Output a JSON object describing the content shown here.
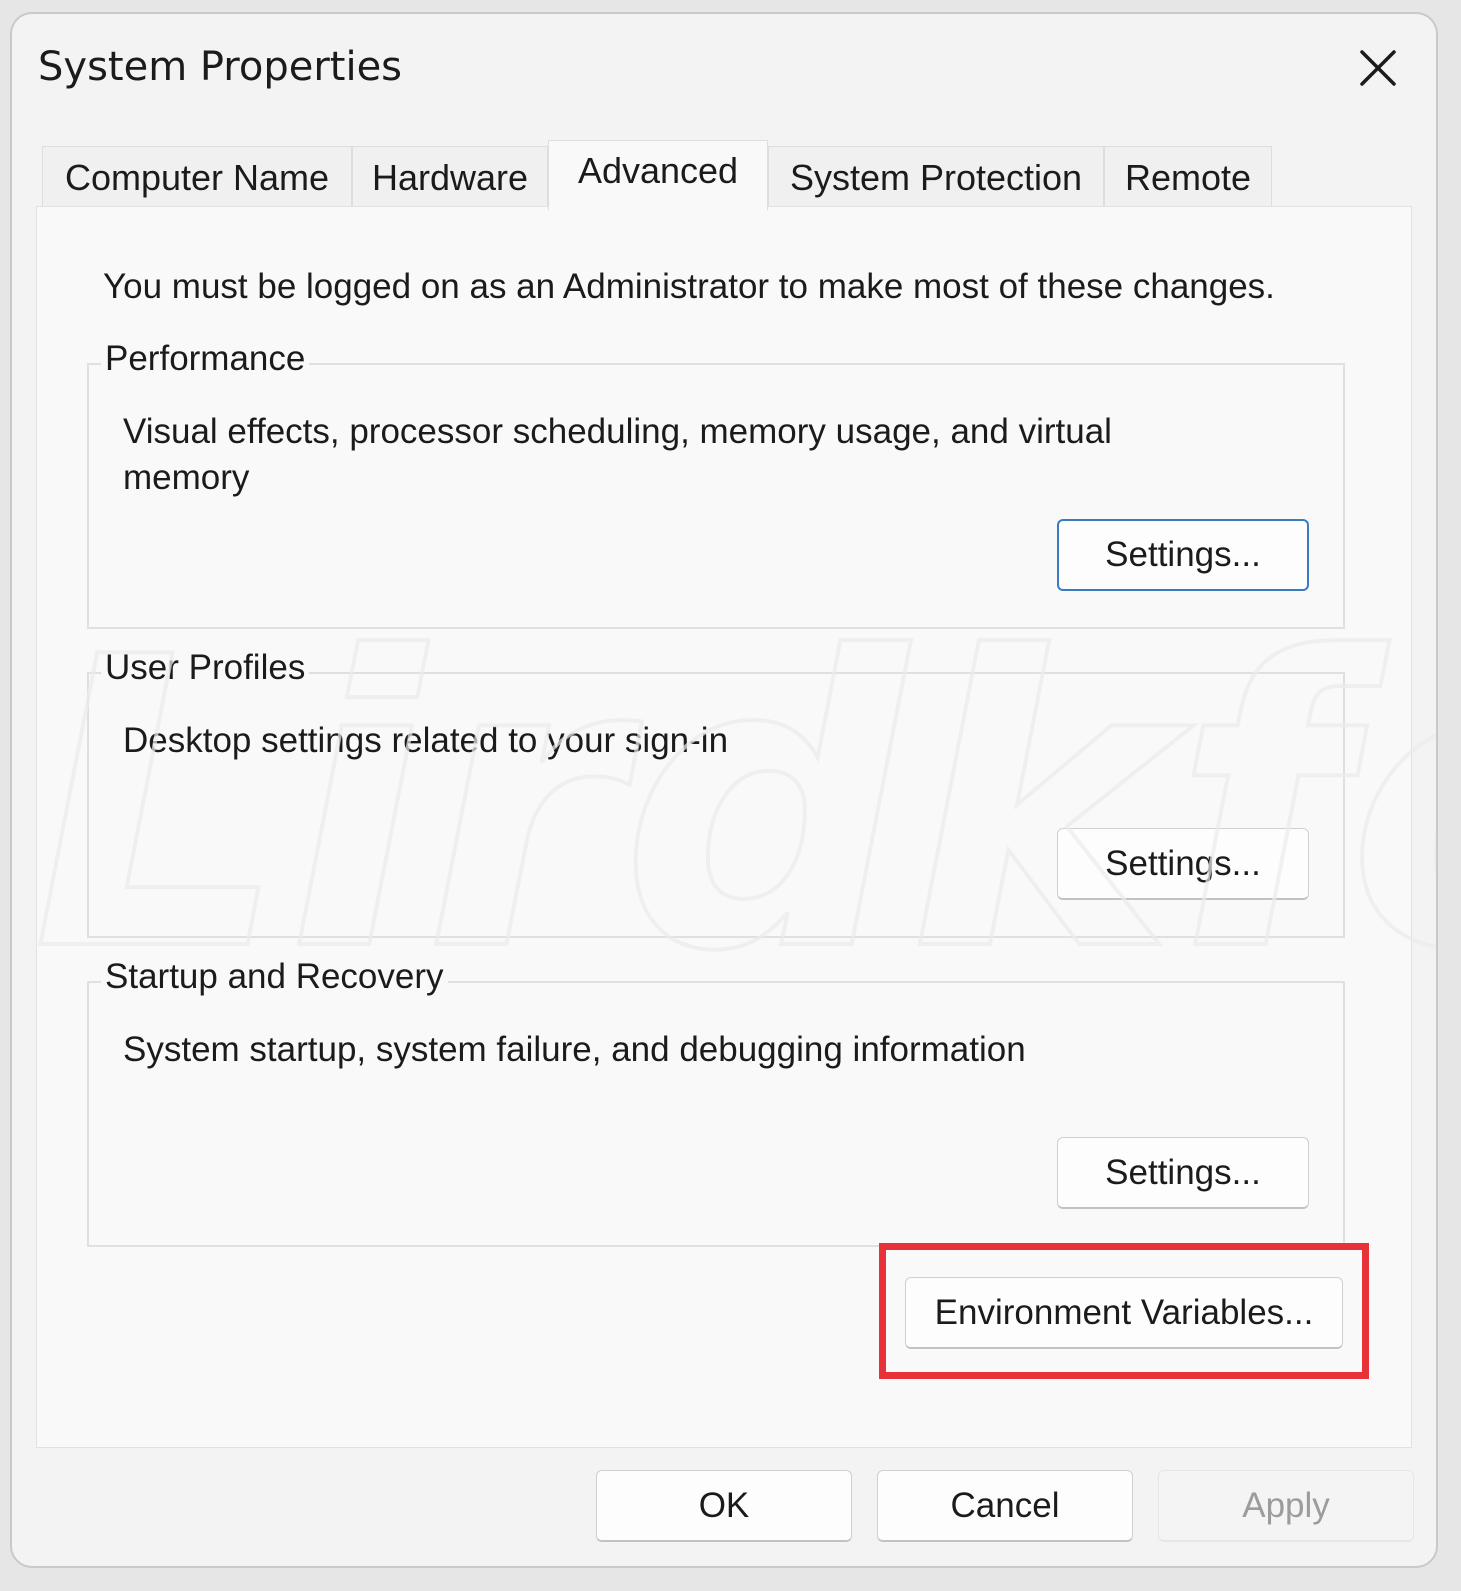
{
  "window": {
    "title": "System Properties"
  },
  "icons": {
    "close": "close-icon"
  },
  "tabs": [
    {
      "label": "Computer Name",
      "active": false
    },
    {
      "label": "Hardware",
      "active": false
    },
    {
      "label": "Advanced",
      "active": true
    },
    {
      "label": "System Protection",
      "active": false
    },
    {
      "label": "Remote",
      "active": false
    }
  ],
  "advanced": {
    "admin_note": "You must be logged on as an Administrator to make most of these changes.",
    "performance": {
      "title": "Performance",
      "description": "Visual effects, processor scheduling, memory usage, and virtual memory",
      "button": "Settings..."
    },
    "user_profiles": {
      "title": "User Profiles",
      "description": "Desktop settings related to your sign-in",
      "button": "Settings..."
    },
    "startup_recovery": {
      "title": "Startup and Recovery",
      "description": "System startup, system failure, and debugging information",
      "button": "Settings..."
    },
    "env_button": "Environment Variables..."
  },
  "footer": {
    "ok": "OK",
    "cancel": "Cancel",
    "apply": "Apply"
  },
  "colors": {
    "highlight": "#e8323a",
    "focus": "#3a7cc2"
  },
  "watermark": {
    "text": "Lirdkfox"
  }
}
